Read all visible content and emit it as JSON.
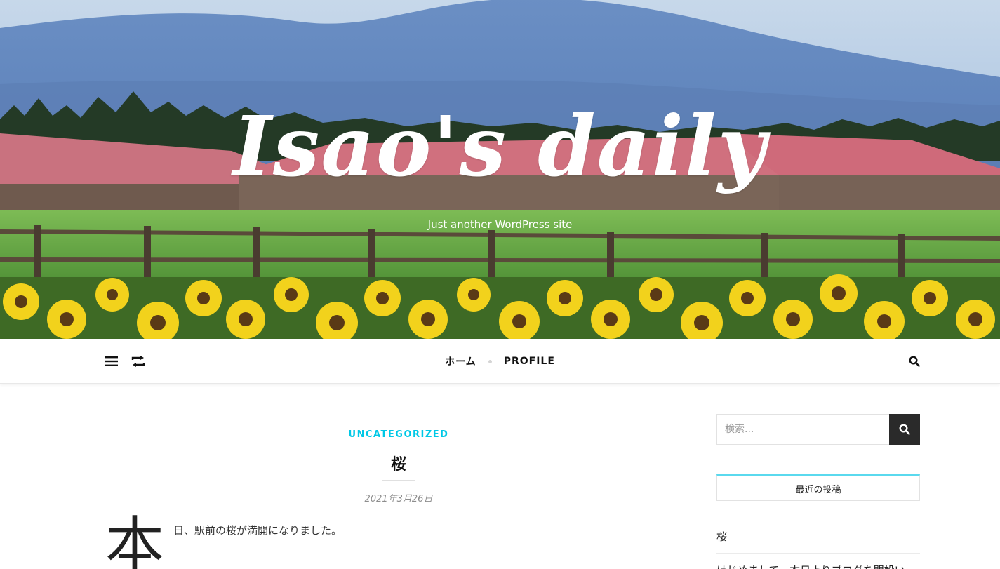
{
  "site": {
    "title": "Isao's daily",
    "tagline": "Just another WordPress site"
  },
  "nav": {
    "items": [
      "ホーム",
      "PROFILE"
    ]
  },
  "post": {
    "category": "UNCATEGORIZED",
    "title": "桜",
    "date": "2021年3月26日",
    "dropcap": "本",
    "body": "日、駅前の桜が満開になりました。"
  },
  "sidebar": {
    "search_placeholder": "検索...",
    "widget_title": "最近の投稿",
    "recent_posts": [
      "桜",
      "はじめまして。本日よりブログを開設い"
    ]
  },
  "colors": {
    "accent": "#00c8e6",
    "widget_border": "#5ad9ee",
    "search_button": "#2a2a2a"
  }
}
